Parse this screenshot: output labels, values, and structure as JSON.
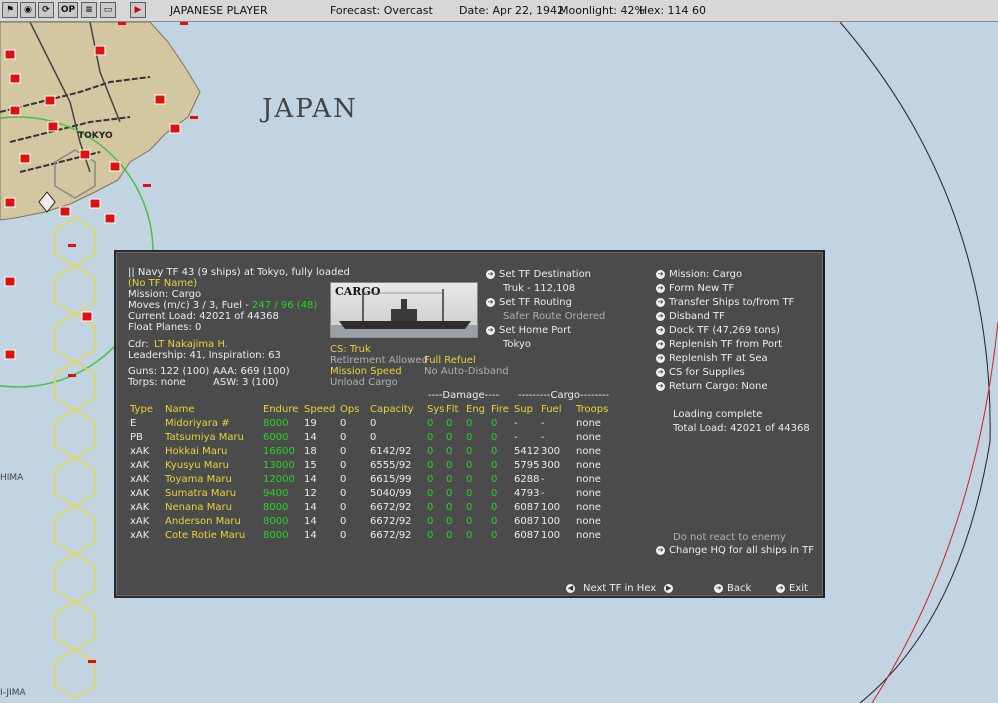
{
  "topbar": {
    "buttons": [
      "OP"
    ],
    "player": "JAPANESE PLAYER",
    "forecast": "Forecast: Overcast",
    "date": "Date: Apr 22, 1942",
    "moonlight": "Moonlight: 42%",
    "hex": "Hex: 114 60"
  },
  "map": {
    "labels": {
      "japan": "JAPAN",
      "tokyo": "TOKYO",
      "hima": "HIMA",
      "jima": "I-JIMA"
    }
  },
  "panel": {
    "header": {
      "title": "|| Navy TF 43 (9 ships) at Tokyo, fully loaded",
      "tf_name": "(No TF Name)",
      "mission": "Mission: Cargo",
      "moves_prefix": "Moves (m/c) 3 / 3, Fuel - ",
      "fuel": "247 / 96 (48)",
      "current_load": "Current Load: 42021 of 44368",
      "float_planes": "Float Planes: 0",
      "cdr_label": "Cdr:",
      "commander": "LT Nakajima H.",
      "leadership": "Leadership: 41, Inspiration: 63",
      "guns": "Guns: 122 (100)",
      "aaa": "AAA: 669 (100)",
      "torps": "Torps: none",
      "asw": "ASW: 3 (100)"
    },
    "ship_image_label": "CARGO",
    "options": {
      "cs": "CS: Truk",
      "retirement": "Retirement Allowed",
      "full_refuel": "Full Refuel",
      "mission_speed": "Mission Speed",
      "auto_disband": "No Auto-Disband",
      "unload": "Unload Cargo"
    },
    "routing": {
      "set_destination": "Set TF Destination",
      "destination": "Truk - 112,108",
      "set_routing": "Set TF Routing",
      "routing_value": "Safer Route Ordered",
      "set_home": "Set Home Port",
      "home": "Tokyo"
    },
    "actions": [
      "Mission: Cargo",
      "Form New TF",
      "Transfer Ships to/from TF",
      "Disband TF",
      "Dock TF (47,269 tons)",
      "Replenish TF from Port",
      "Replenish TF at Sea",
      "CS for Supplies",
      "Return Cargo: None"
    ],
    "status": {
      "loading": "Loading complete",
      "total_load": "Total Load: 42021 of 44368"
    },
    "react": "Do not react to enemy",
    "change_hq": "Change HQ for all ships in TF",
    "nav": {
      "next_tf": "Next TF in Hex",
      "back": "Back",
      "exit": "Exit"
    },
    "table": {
      "group_damage": "----Damage----",
      "group_cargo": "---------Cargo--------",
      "headers": [
        "Type",
        "Name",
        "Endure",
        "Speed",
        "Ops",
        "Capacity",
        "Sys",
        "Flt",
        "Eng",
        "Fire",
        "Sup",
        "Fuel",
        "Troops"
      ],
      "rows": [
        [
          "E",
          "Midoriyara #",
          "8000",
          "19",
          "0",
          "0",
          "0",
          "0",
          "0",
          "0",
          "-",
          "-",
          "none"
        ],
        [
          "PB",
          "Tatsumiya Maru",
          "6000",
          "14",
          "0",
          "0",
          "0",
          "0",
          "0",
          "0",
          "-",
          "-",
          "none"
        ],
        [
          "xAK",
          "Hokkai Maru",
          "16600",
          "18",
          "0",
          "6142/92",
          "0",
          "0",
          "0",
          "0",
          "5412",
          "300",
          "none"
        ],
        [
          "xAK",
          "Kyusyu Maru",
          "13000",
          "15",
          "0",
          "6555/92",
          "0",
          "0",
          "0",
          "0",
          "5795",
          "300",
          "none"
        ],
        [
          "xAK",
          "Toyama Maru",
          "12000",
          "14",
          "0",
          "6615/99",
          "0",
          "0",
          "0",
          "0",
          "6288",
          "-",
          "none"
        ],
        [
          "xAK",
          "Sumatra Maru",
          "9400",
          "12",
          "0",
          "5040/99",
          "0",
          "0",
          "0",
          "0",
          "4793",
          "-",
          "none"
        ],
        [
          "xAK",
          "Nenana Maru",
          "8000",
          "14",
          "0",
          "6672/92",
          "0",
          "0",
          "0",
          "0",
          "6087",
          "100",
          "none"
        ],
        [
          "xAK",
          "Anderson Maru",
          "8000",
          "14",
          "0",
          "6672/92",
          "0",
          "0",
          "0",
          "0",
          "6087",
          "100",
          "none"
        ],
        [
          "xAK",
          "Cote Rotie Maru",
          "8000",
          "14",
          "0",
          "6672/92",
          "0",
          "0",
          "0",
          "0",
          "6087",
          "100",
          "none"
        ]
      ]
    }
  }
}
